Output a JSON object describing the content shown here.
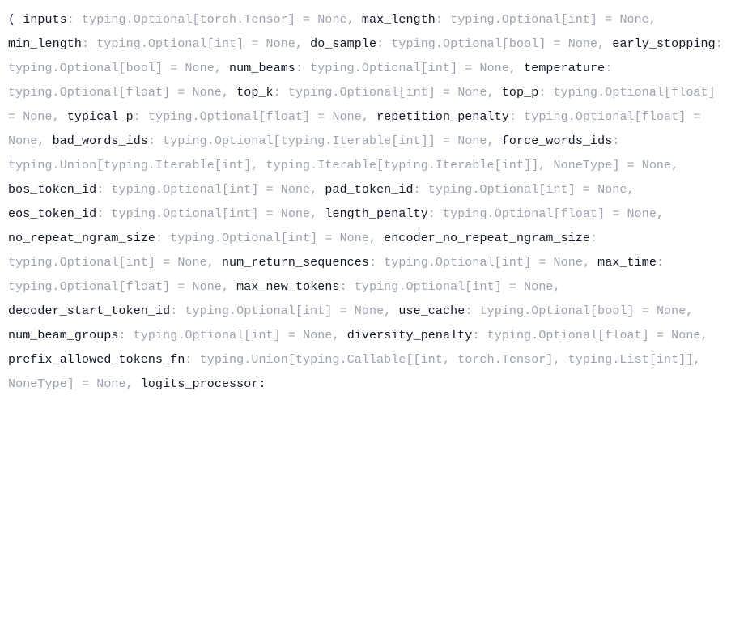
{
  "signature": {
    "open_paren": "(",
    "params": [
      {
        "name": "inputs",
        "type": "typing.Optional[torch.Tensor] = None"
      },
      {
        "name": "max_length",
        "type": "typing.Optional[int] = None"
      },
      {
        "name": "min_length",
        "type": "typing.Optional[int] = None"
      },
      {
        "name": "do_sample",
        "type": "typing.Optional[bool] = None"
      },
      {
        "name": "early_stopping",
        "type": "typing.Optional[bool] = None"
      },
      {
        "name": "num_beams",
        "type": "typing.Optional[int] = None"
      },
      {
        "name": "temperature",
        "type": "typing.Optional[float] = None"
      },
      {
        "name": "top_k",
        "type": "typing.Optional[int] = None"
      },
      {
        "name": "top_p",
        "type": "typing.Optional[float] = None"
      },
      {
        "name": "typical_p",
        "type": "typing.Optional[float] = None"
      },
      {
        "name": "repetition_penalty",
        "type": "typing.Optional[float] = None"
      },
      {
        "name": "bad_words_ids",
        "type": "typing.Optional[typing.Iterable[int]] = None"
      },
      {
        "name": "force_words_ids",
        "type": "typing.Union[typing.Iterable[int], typing.Iterable[typing.Iterable[int]], NoneType] = None"
      },
      {
        "name": "bos_token_id",
        "type": "typing.Optional[int] = None"
      },
      {
        "name": "pad_token_id",
        "type": "typing.Optional[int] = None"
      },
      {
        "name": "eos_token_id",
        "type": "typing.Optional[int] = None"
      },
      {
        "name": "length_penalty",
        "type": "typing.Optional[float] = None"
      },
      {
        "name": "no_repeat_ngram_size",
        "type": "typing.Optional[int] = None"
      },
      {
        "name": "encoder_no_repeat_ngram_size",
        "type": "typing.Optional[int] = None"
      },
      {
        "name": "num_return_sequences",
        "type": "typing.Optional[int] = None"
      },
      {
        "name": "max_time",
        "type": "typing.Optional[float] = None"
      },
      {
        "name": "max_new_tokens",
        "type": "typing.Optional[int] = None"
      },
      {
        "name": "decoder_start_token_id",
        "type": "typing.Optional[int] = None"
      },
      {
        "name": "use_cache",
        "type": "typing.Optional[bool] = None"
      },
      {
        "name": "num_beam_groups",
        "type": "typing.Optional[int] = None"
      },
      {
        "name": "diversity_penalty",
        "type": "typing.Optional[float] = None"
      },
      {
        "name": "prefix_allowed_tokens_fn",
        "type": "typing.Union[typing.Callable[[int, torch.Tensor], typing.List[int]], NoneType] = None"
      },
      {
        "name": "logits_processor",
        "type": ""
      }
    ],
    "sep": ", ",
    "colon": ": ",
    "trailing_colon": ":"
  }
}
